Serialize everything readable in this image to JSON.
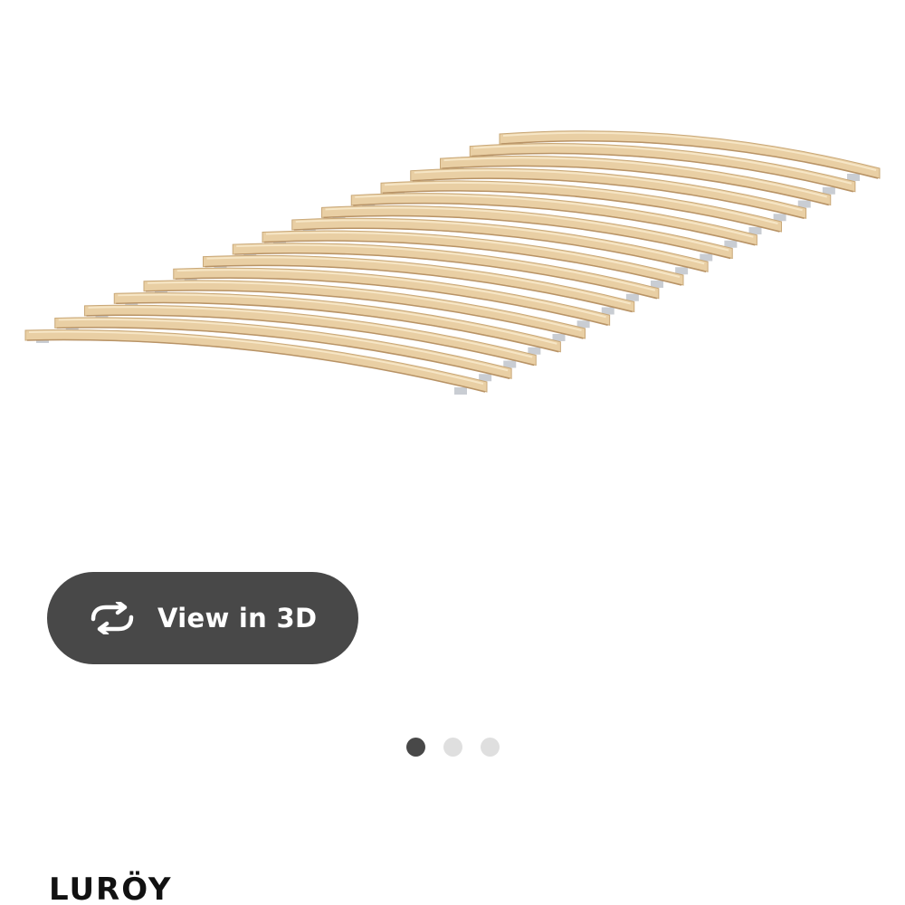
{
  "gallery": {
    "image_icon": "slatted-bed-base-image",
    "view_3d": {
      "label": "View in 3D",
      "icon": "rotate-arrows-icon"
    },
    "dots": [
      {
        "active": true
      },
      {
        "active": false
      },
      {
        "active": false
      }
    ]
  },
  "product": {
    "name": "LURÖY"
  },
  "colors": {
    "button_bg": "#484848",
    "dot_active": "#484848",
    "dot_inactive": "#dfdfdf",
    "wood": "#e9cfa4"
  }
}
